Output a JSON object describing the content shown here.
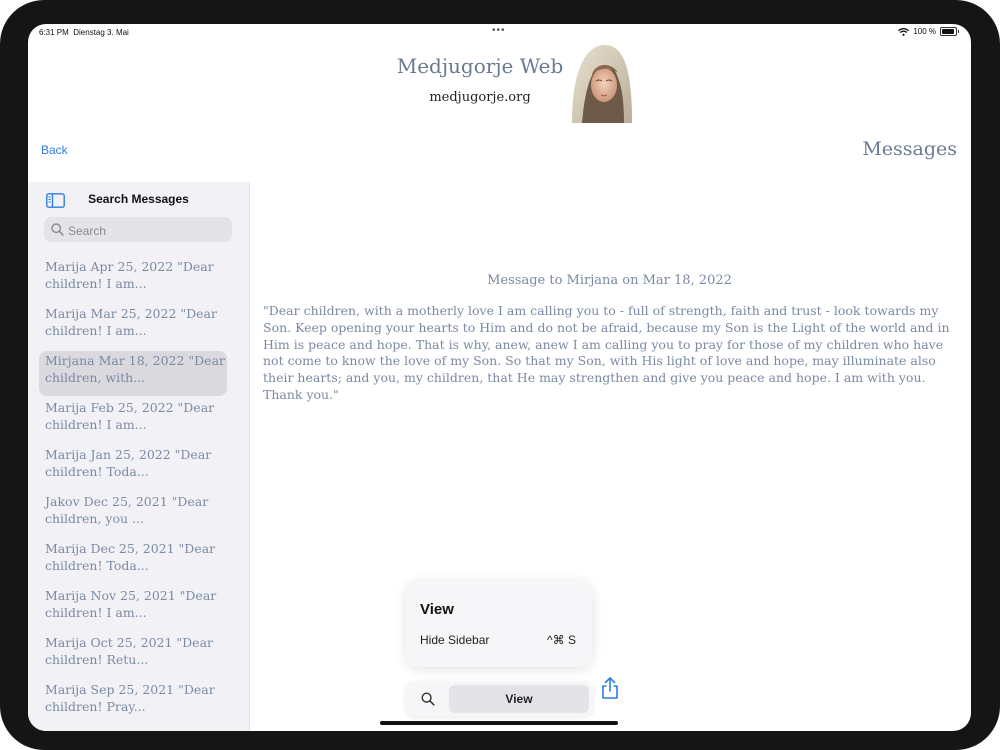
{
  "status_bar": {
    "time": "6:31 PM",
    "date": "Dienstag 3. Mai",
    "battery": "100 %"
  },
  "header": {
    "title": "Medjugorje Web",
    "subtitle": "medjugorje.org"
  },
  "nav": {
    "back_label": "Back",
    "title": "Messages"
  },
  "sidebar": {
    "title": "Search Messages",
    "search_placeholder": "Search",
    "items": [
      {
        "line1": "Marija Apr 25, 2022 \"Dear",
        "line2": "children! I am..."
      },
      {
        "line1": "Marija Mar 25, 2022 \"Dear",
        "line2": "children! I am..."
      },
      {
        "line1": "Mirjana Mar 18, 2022 \"Dear",
        "line2": "children, with..."
      },
      {
        "line1": "Marija Feb 25, 2022 \"Dear",
        "line2": "children! I am..."
      },
      {
        "line1": "Marija Jan 25, 2022 \"Dear",
        "line2": "children! Toda..."
      },
      {
        "line1": "Jakov Dec 25, 2021 \"Dear",
        "line2": "children, you ..."
      },
      {
        "line1": "Marija Dec 25, 2021 \"Dear",
        "line2": "children! Toda..."
      },
      {
        "line1": "Marija Nov 25, 2021 \"Dear",
        "line2": "children! I am..."
      },
      {
        "line1": "Marija Oct 25, 2021 \"Dear",
        "line2": "children! Retu..."
      },
      {
        "line1": "Marija Sep 25, 2021 \"Dear",
        "line2": "children! Pray..."
      }
    ],
    "selected_index": 2
  },
  "content": {
    "heading": "Message to Mirjana on Mar 18, 2022",
    "body": "\"Dear children, with a motherly love I am calling you to - full of strength, faith and trust - look towards my Son. Keep opening your hearts to Him and do not be afraid, because my Son is the Light of the world and in Him is peace and hope. That is why, anew, anew I am calling you to pray for those of my children who have not come to know the love of my Son. So that my Son, with His light of love and hope, may illuminate also their hearts; and you, my children, that He may strengthen and give you peace and hope. I am with you. Thank you.\""
  },
  "view_menu": {
    "title": "View",
    "item_label": "Hide Sidebar",
    "item_shortcut": "^⌘ S"
  },
  "bottom_bar": {
    "view_label": "View"
  },
  "colors": {
    "accent": "#2f7de1",
    "text_blue_gray": "#7a8aa3",
    "sidebar_bg": "#f2f2f6",
    "selected_bg": "#d9d9de"
  },
  "icons": {
    "sidebar_toggle": "sidebar-toggle-icon",
    "search": "search-icon",
    "share": "share-icon",
    "wifi": "wifi-icon",
    "battery": "battery-icon"
  }
}
